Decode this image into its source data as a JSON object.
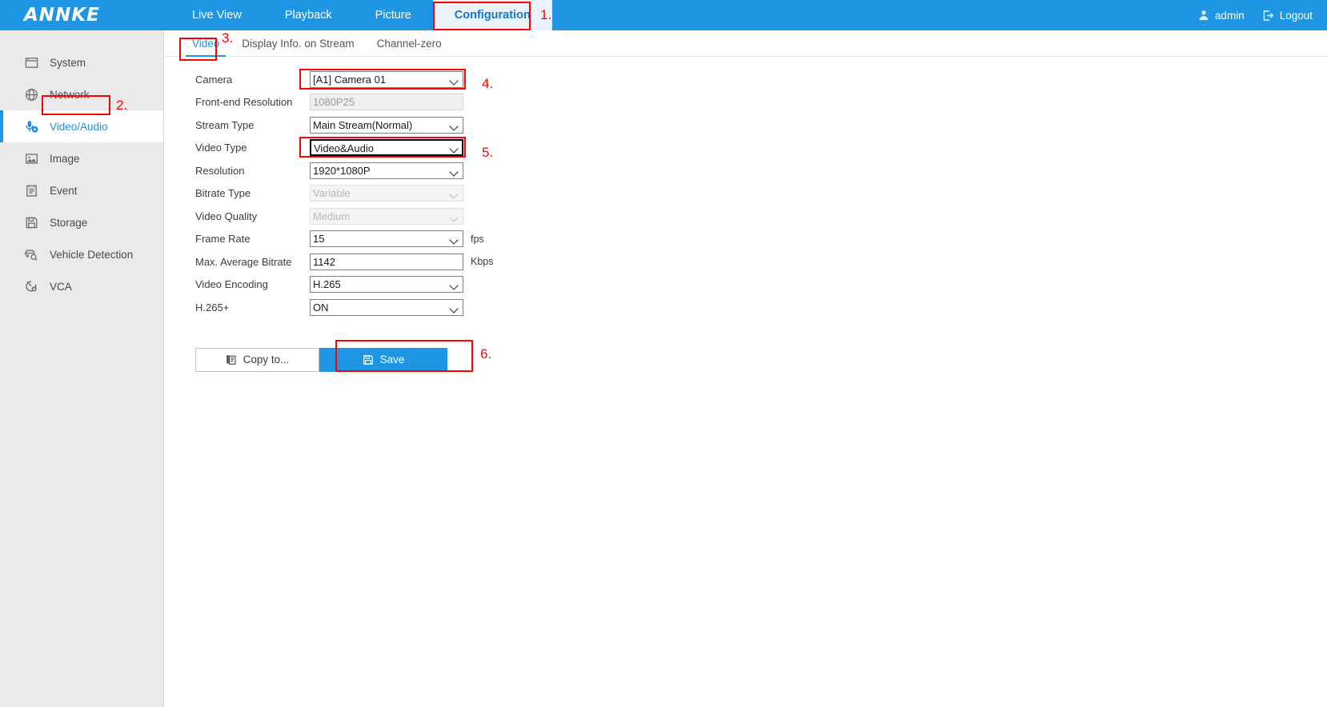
{
  "header": {
    "brand": "ANNKE",
    "nav": [
      {
        "label": "Live View",
        "active": false
      },
      {
        "label": "Playback",
        "active": false
      },
      {
        "label": "Picture",
        "active": false
      },
      {
        "label": "Configuration",
        "active": true
      }
    ],
    "user": {
      "name": "admin",
      "user_icon": "user-icon",
      "logout_label": "Logout",
      "logout_icon": "logout-icon"
    },
    "accent_color": "#1E96E3",
    "active_tab_bg": "#EAF3FB",
    "active_tab_text": "#1477C9"
  },
  "sidebar": {
    "bg_color": "#EAEAEA",
    "items": [
      {
        "label": "System",
        "icon": "system-window-icon",
        "active": false
      },
      {
        "label": "Network",
        "icon": "globe-icon",
        "active": false
      },
      {
        "label": "Video/Audio",
        "icon": "video-audio-icon",
        "active": true
      },
      {
        "label": "Image",
        "icon": "picture-icon",
        "active": false
      },
      {
        "label": "Event",
        "icon": "calendar-list-icon",
        "active": false
      },
      {
        "label": "Storage",
        "icon": "floppy-disk-icon",
        "active": false
      },
      {
        "label": "Vehicle Detection",
        "icon": "vehicle-search-icon",
        "active": false
      },
      {
        "label": "VCA",
        "icon": "vca-icon",
        "active": false
      }
    ]
  },
  "tabs": [
    {
      "label": "Video",
      "active": true
    },
    {
      "label": "Display Info. on Stream",
      "active": false
    },
    {
      "label": "Channel-zero",
      "active": false
    }
  ],
  "form": {
    "rows": [
      {
        "label": "Camera",
        "type": "select",
        "value": "[A1] Camera 01",
        "unit": "",
        "disabled": false,
        "focused": false
      },
      {
        "label": "Front-end Resolution",
        "type": "text",
        "value": "1080P25",
        "unit": "",
        "disabled": true,
        "focused": false
      },
      {
        "label": "Stream Type",
        "type": "select",
        "value": "Main Stream(Normal)",
        "unit": "",
        "disabled": false,
        "focused": false
      },
      {
        "label": "Video Type",
        "type": "select",
        "value": "Video&Audio",
        "unit": "",
        "disabled": false,
        "focused": true
      },
      {
        "label": "Resolution",
        "type": "select",
        "value": "1920*1080P",
        "unit": "",
        "disabled": false,
        "focused": false
      },
      {
        "label": "Bitrate Type",
        "type": "select",
        "value": "Variable",
        "unit": "",
        "disabled": true,
        "focused": false
      },
      {
        "label": "Video Quality",
        "type": "select",
        "value": "Medium",
        "unit": "",
        "disabled": true,
        "focused": false
      },
      {
        "label": "Frame Rate",
        "type": "select",
        "value": "15",
        "unit": "fps",
        "disabled": false,
        "focused": false
      },
      {
        "label": "Max. Average Bitrate",
        "type": "text",
        "value": "1142",
        "unit": "Kbps",
        "disabled": false,
        "focused": false
      },
      {
        "label": "Video Encoding",
        "type": "select",
        "value": "H.265",
        "unit": "",
        "disabled": false,
        "focused": false
      },
      {
        "label": "H.265+",
        "type": "select",
        "value": "ON",
        "unit": "",
        "disabled": false,
        "focused": false
      }
    ]
  },
  "buttons": {
    "copy_to": {
      "label": "Copy to...",
      "icon": "copy-icon"
    },
    "save": {
      "label": "Save",
      "icon": "save-disk-icon",
      "color": "#1E96E3"
    }
  },
  "annotations": {
    "color": "#FF0000",
    "steps": [
      {
        "number": "1.",
        "target": "configuration-nav-tab"
      },
      {
        "number": "2.",
        "target": "sidebar-item-video-audio"
      },
      {
        "number": "3.",
        "target": "tab-video"
      },
      {
        "number": "4.",
        "target": "camera-select"
      },
      {
        "number": "5.",
        "target": "video-type-select"
      },
      {
        "number": "6.",
        "target": "save-button"
      }
    ]
  }
}
